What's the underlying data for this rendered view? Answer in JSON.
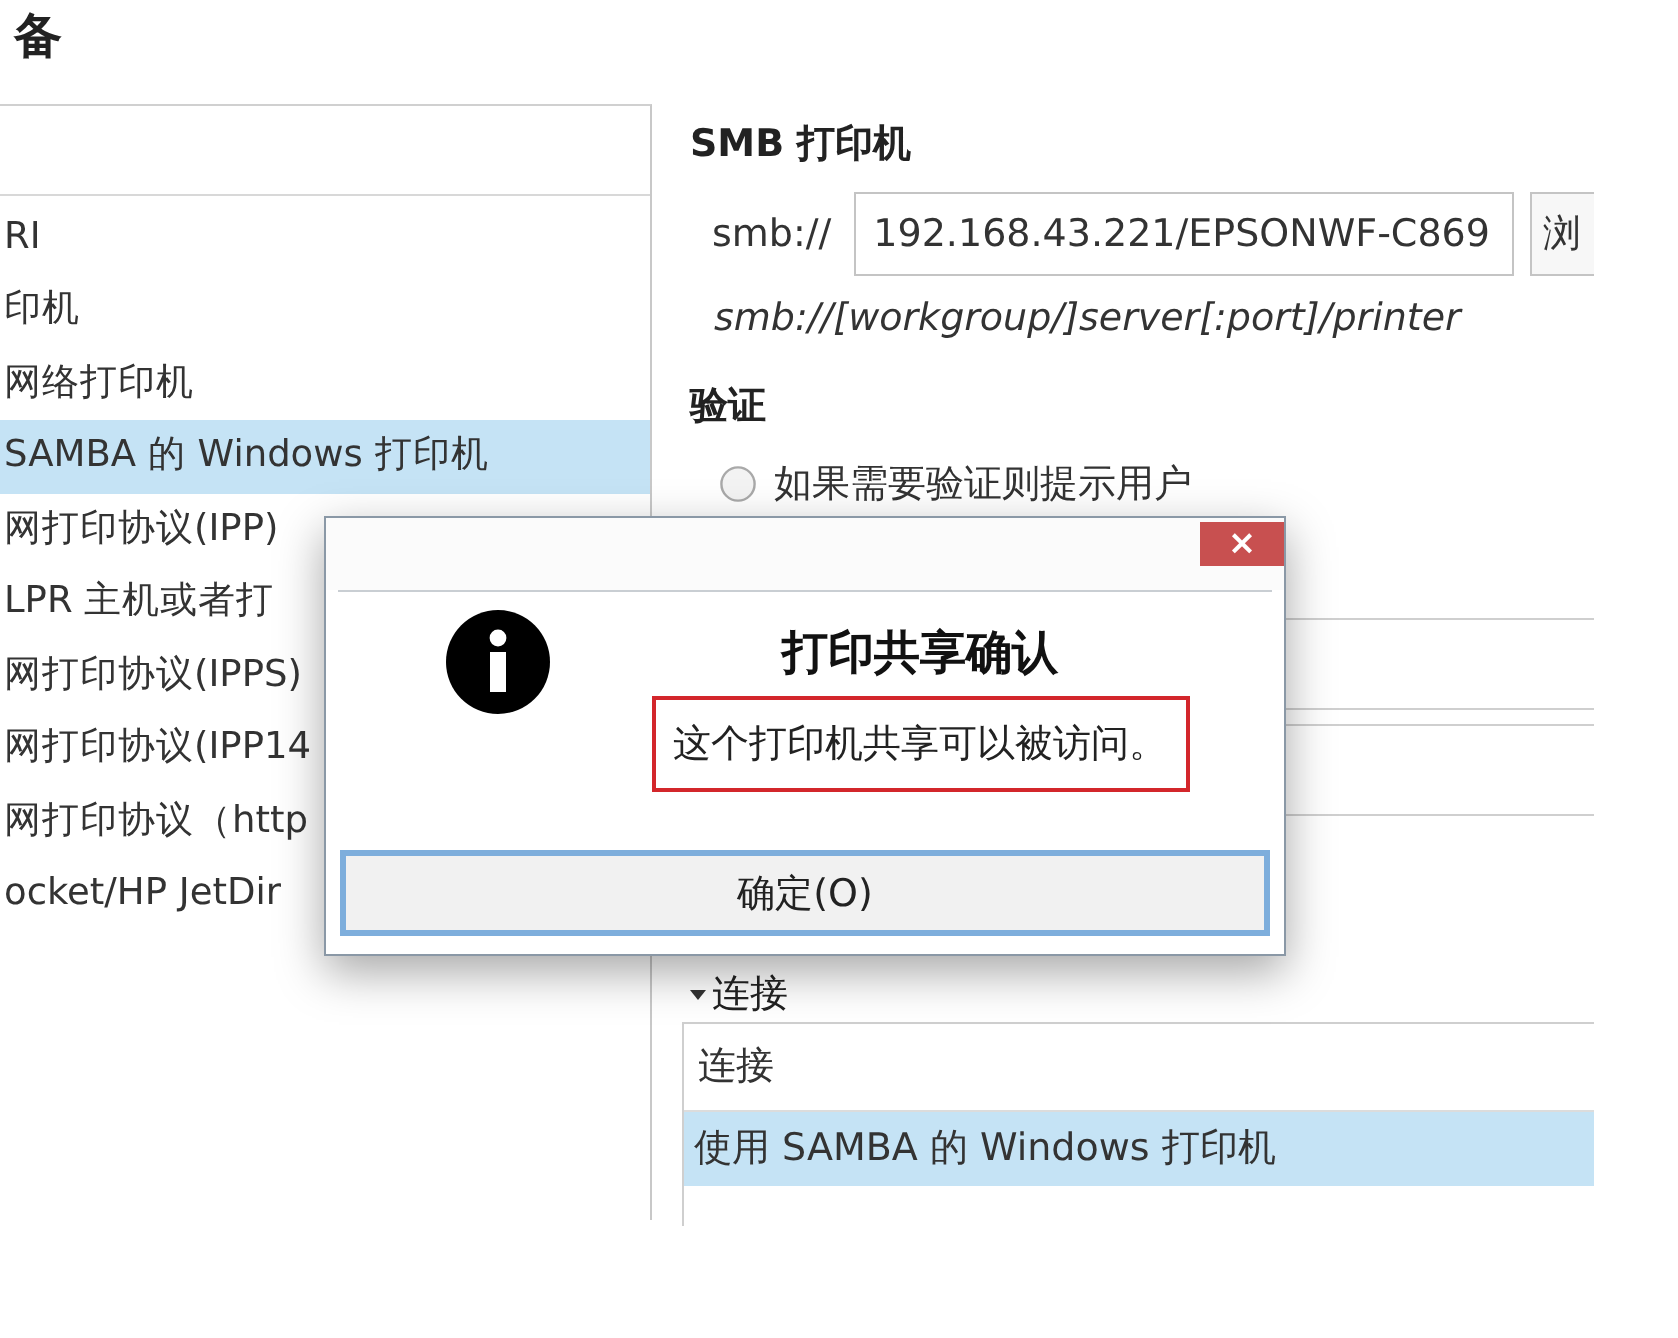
{
  "window": {
    "title": "备"
  },
  "device_list": {
    "items": [
      {
        "label": "RI",
        "selected": false
      },
      {
        "label": "印机",
        "selected": false
      },
      {
        "label": "网络打印机",
        "selected": false
      },
      {
        "label": "SAMBA 的 Windows 打印机",
        "selected": true
      },
      {
        "label": "网打印协议(IPP)",
        "selected": false
      },
      {
        "label": "LPR 主机或者打",
        "selected": false
      },
      {
        "label": "网打印协议(IPPS)",
        "selected": false
      },
      {
        "label": "网打印协议(IPP14",
        "selected": false
      },
      {
        "label": "网打印协议（http",
        "selected": false
      },
      {
        "label": "ocket/HP JetDir",
        "selected": false
      }
    ]
  },
  "smb_printer": {
    "heading": "SMB 打印机",
    "prefix": "smb://",
    "uri_field": {
      "value": "192.168.43.221/EPSONWF-C869"
    },
    "browse_button": "浏",
    "hint": "smb://[workgroup/]server[:port]/printer"
  },
  "authentication": {
    "heading": "验证",
    "items": [
      {
        "kind": "radio",
        "label": "如果需要验证则提示用户",
        "selected": false
      },
      {
        "kind": "entry"
      },
      {
        "kind": "entry"
      }
    ]
  },
  "connection": {
    "heading": "连接",
    "expanded": true,
    "column_header": "连接",
    "rows": [
      {
        "label": "使用 SAMBA 的 Windows 打印机",
        "selected": true
      }
    ]
  },
  "dialog": {
    "close": "×",
    "title": "打印共享确认",
    "message": "这个打印机共享可以被访问。",
    "message_highlighted": true,
    "button": "确定(O)",
    "button_focused": true
  }
}
